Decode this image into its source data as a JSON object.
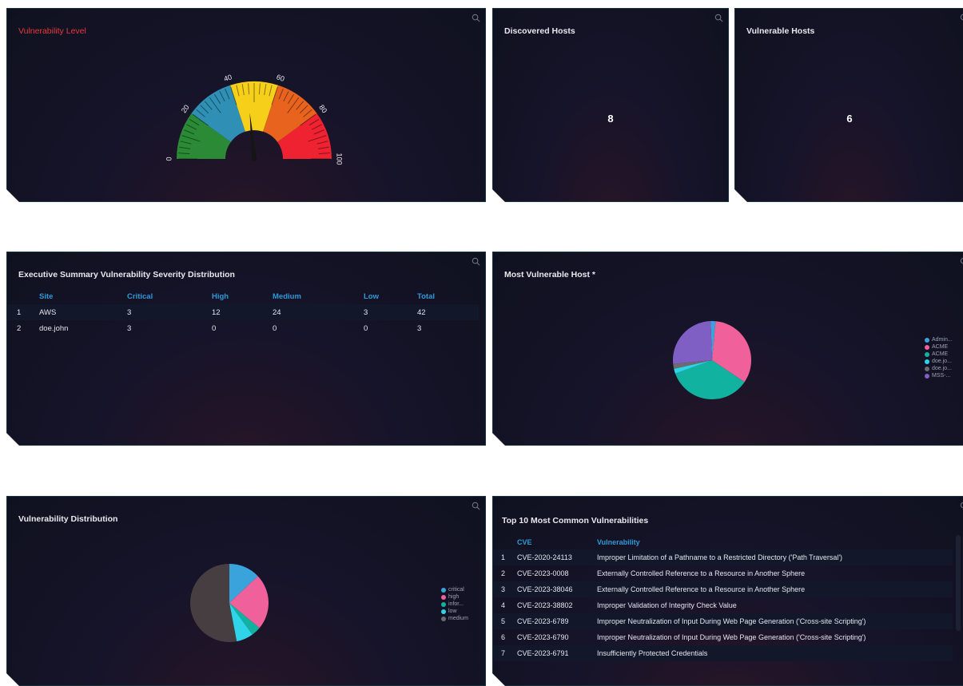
{
  "panels": {
    "vuln_level": {
      "title": "Vulnerability Level",
      "gauge_value": 47,
      "ticks": [
        "0",
        "20",
        "40",
        "60",
        "80",
        "100"
      ]
    },
    "discovered_hosts": {
      "title": "Discovered Hosts",
      "value": "8"
    },
    "vulnerable_hosts": {
      "title": "Vulnerable Hosts",
      "value": "6"
    },
    "exec_summary": {
      "title": "Executive Summary Vulnerability Severity Distribution",
      "columns": [
        "Site",
        "Critical",
        "High",
        "Medium",
        "Low",
        "Total"
      ],
      "rows": [
        {
          "n": "1",
          "site": "AWS",
          "critical": "3",
          "high": "12",
          "medium": "24",
          "low": "3",
          "total": "42"
        },
        {
          "n": "2",
          "site": "doe.john",
          "critical": "3",
          "high": "0",
          "medium": "0",
          "low": "0",
          "total": "3"
        }
      ]
    },
    "most_vulnerable_host": {
      "title": "Most Vulnerable Host *",
      "legend": [
        {
          "label": "Admin...",
          "color": "#3aa3dc"
        },
        {
          "label": "ACME",
          "color": "#f0609a"
        },
        {
          "label": "ACME",
          "color": "#11b3a0"
        },
        {
          "label": "doe.jo...",
          "color": "#2fd4e8"
        },
        {
          "label": "doe.jo...",
          "color": "#6b6b70"
        },
        {
          "label": "MSS-...",
          "color": "#7f5fc4"
        }
      ]
    },
    "vuln_distribution": {
      "title": "Vulnerability Distribution",
      "legend": [
        {
          "label": "critical",
          "color": "#3aa3dc"
        },
        {
          "label": "high",
          "color": "#f0609a"
        },
        {
          "label": "infor...",
          "color": "#11b3a0"
        },
        {
          "label": "low",
          "color": "#2fd4e8"
        },
        {
          "label": "medium",
          "color": "#6b6b70"
        }
      ]
    },
    "top10": {
      "title": "Top 10 Most Common Vulnerabilities",
      "columns": [
        "CVE",
        "Vulnerability"
      ],
      "rows": [
        {
          "n": "1",
          "cve": "CVE-2020-24113",
          "vuln": "Improper Limitation of a Pathname to a Restricted Directory ('Path Traversal')"
        },
        {
          "n": "2",
          "cve": "CVE-2023-0008",
          "vuln": "Externally Controlled Reference to a Resource in Another Sphere"
        },
        {
          "n": "3",
          "cve": "CVE-2023-38046",
          "vuln": "Externally Controlled Reference to a Resource in Another Sphere"
        },
        {
          "n": "4",
          "cve": "CVE-2023-38802",
          "vuln": "Improper Validation of Integrity Check Value"
        },
        {
          "n": "5",
          "cve": "CVE-2023-6789",
          "vuln": "Improper Neutralization of Input During Web Page Generation ('Cross-site Scripting')"
        },
        {
          "n": "6",
          "cve": "CVE-2023-6790",
          "vuln": "Improper Neutralization of Input During Web Page Generation ('Cross-site Scripting')"
        },
        {
          "n": "7",
          "cve": "CVE-2023-6791",
          "vuln": "Insufficiently Protected Credentials"
        }
      ]
    }
  },
  "chart_data": [
    {
      "type": "pie",
      "series": [
        {
          "values": [
            2,
            33,
            35,
            2,
            2,
            26
          ]
        }
      ],
      "categories": [
        "Admin...",
        "ACME",
        "ACME",
        "doe.jo...",
        "doe.jo...",
        "MSS-..."
      ],
      "colors": [
        "#3aa3dc",
        "#f0609a",
        "#11b3a0",
        "#2fd4e8",
        "#6b6b70",
        "#7f5fc4"
      ]
    },
    {
      "type": "pie",
      "series": [
        {
          "values": [
            13,
            23,
            4,
            7,
            53
          ]
        }
      ],
      "categories": [
        "critical",
        "high",
        "infor...",
        "low",
        "medium"
      ],
      "colors": [
        "#3aa3dc",
        "#f0609a",
        "#11b3a0",
        "#2fd4e8",
        "#463e40"
      ]
    }
  ]
}
